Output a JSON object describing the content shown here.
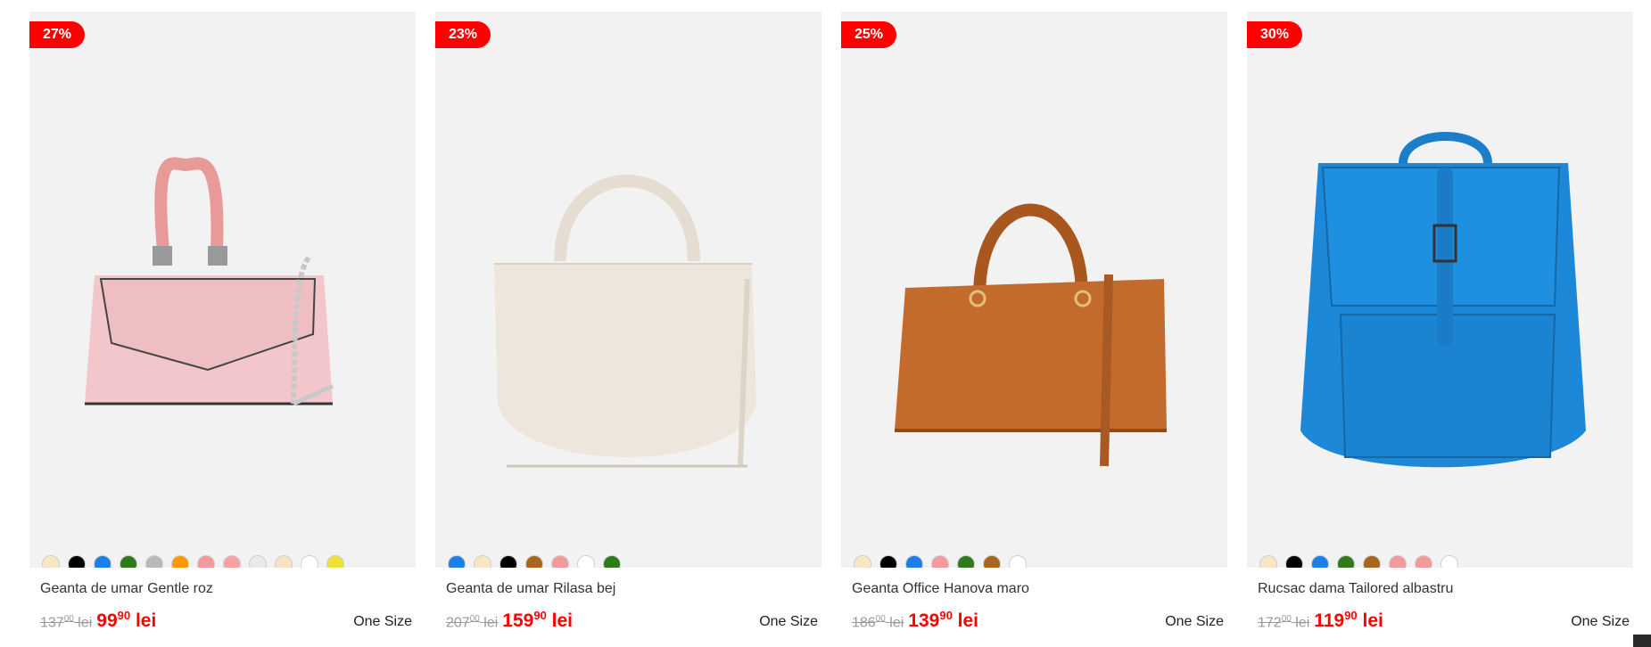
{
  "products": [
    {
      "discount": "27%",
      "name": "Geanta de umar Gentle roz",
      "old_int": "137",
      "old_dec": "00",
      "old_cur": "lei",
      "new_int": "99",
      "new_dec": "90",
      "new_cur": "lei",
      "size": "One Size",
      "image": "pink-handbag",
      "swatches": [
        "#f7e7c4",
        "#000000",
        "#1a7fe8",
        "#2f7a1f",
        "#b9b9b9",
        "#ff9800",
        "#f39a9a",
        "#f7a1a1",
        "#eaeaea",
        "#f6e4c4",
        "#ffffff",
        "#eee138"
      ]
    },
    {
      "discount": "23%",
      "name": "Geanta de umar Rilasa bej",
      "old_int": "207",
      "old_dec": "00",
      "old_cur": "lei",
      "new_int": "159",
      "new_dec": "90",
      "new_cur": "lei",
      "size": "One Size",
      "image": "beige-tote",
      "swatches": [
        "#1a7fe8",
        "#f7e7c4",
        "#000000",
        "#a8651f",
        "#f49a9a",
        "#ffffff",
        "#2f7a1f"
      ]
    },
    {
      "discount": "25%",
      "name": "Geanta Office Hanova maro",
      "old_int": "186",
      "old_dec": "00",
      "old_cur": "lei",
      "new_int": "139",
      "new_dec": "90",
      "new_cur": "lei",
      "size": "One Size",
      "image": "brown-handbag",
      "swatches": [
        "#f7e7c4",
        "#000000",
        "#1a7fe8",
        "#f39a9a",
        "#2f7a1f",
        "#a8651f",
        "#ffffff"
      ]
    },
    {
      "discount": "30%",
      "name": "Rucsac dama Tailored albastru",
      "old_int": "172",
      "old_dec": "00",
      "old_cur": "lei",
      "new_int": "119",
      "new_dec": "90",
      "new_cur": "lei",
      "size": "One Size",
      "image": "blue-backpack",
      "swatches": [
        "#f7e7c4",
        "#000000",
        "#1a7fe8",
        "#2f7a1f",
        "#a8651f",
        "#f39a9a",
        "#f49a9a",
        "#ffffff"
      ]
    }
  ]
}
